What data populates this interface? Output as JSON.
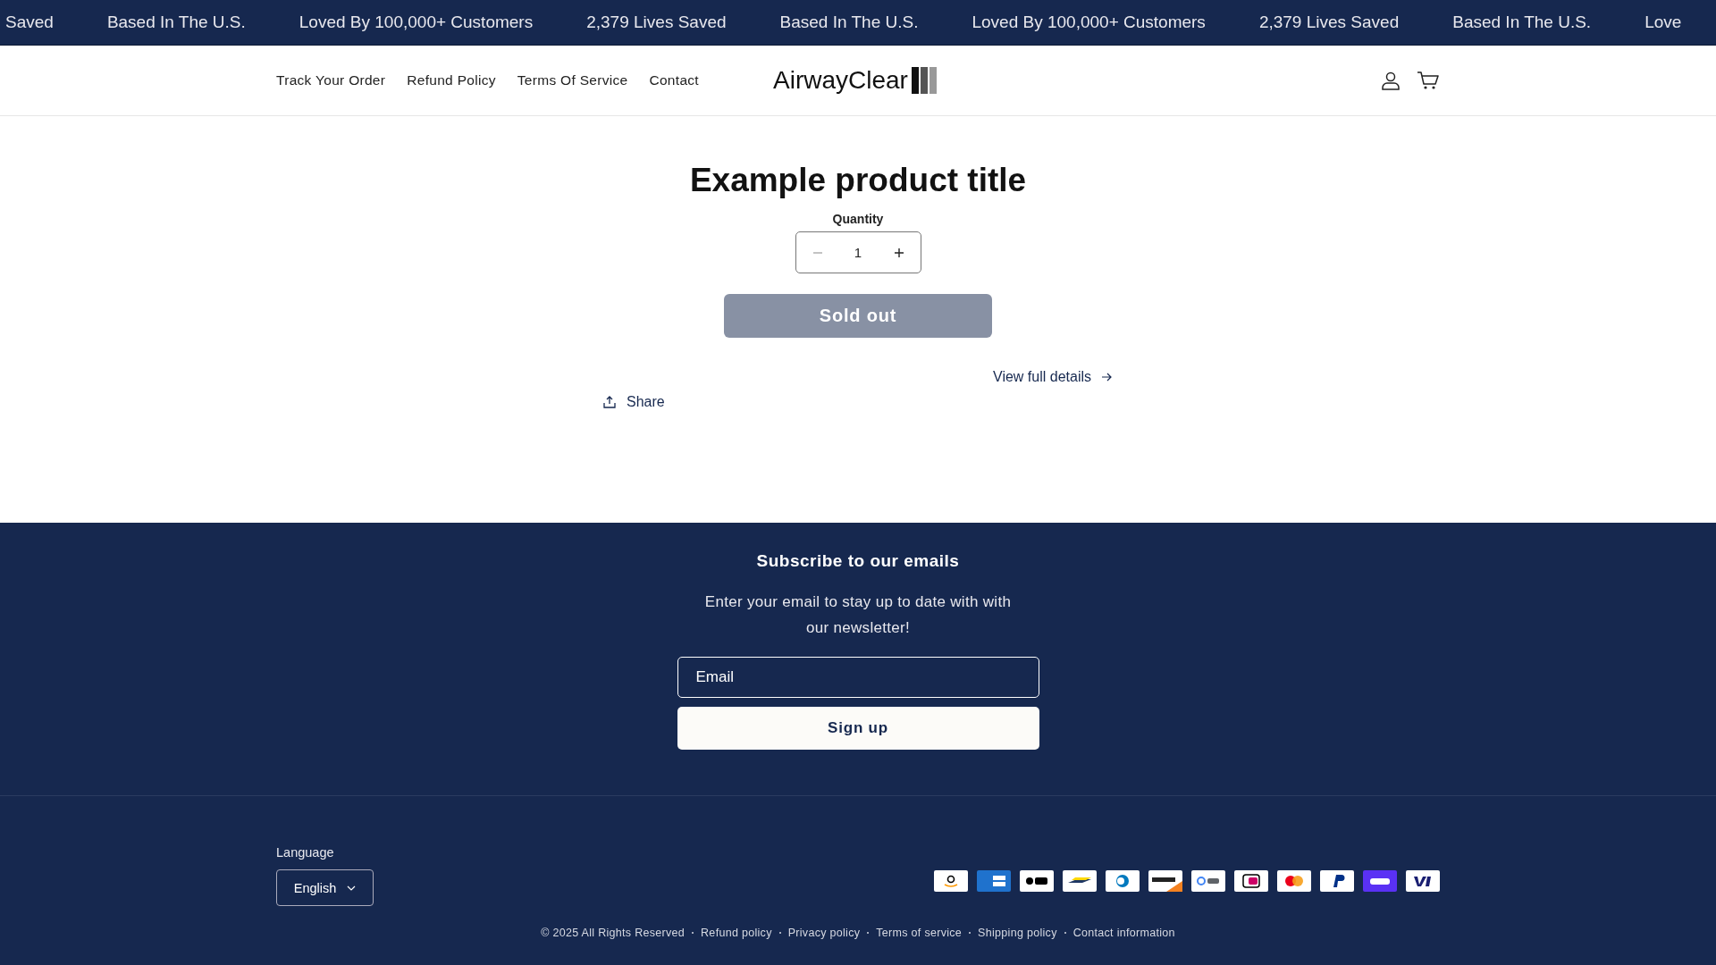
{
  "announcements": [
    "Saved",
    "Based In The U.S.",
    "Loved By 100,000+ Customers",
    "2,379 Lives Saved",
    "Based In The U.S.",
    "Loved By 100,000+ Customers",
    "2,379 Lives Saved",
    "Based In The U.S.",
    "Love"
  ],
  "nav": [
    "Track Your Order",
    "Refund Policy",
    "Terms Of Service",
    "Contact"
  ],
  "logo": "AirwayClear",
  "product": {
    "title": "Example product title",
    "quantity_label": "Quantity",
    "quantity": "1",
    "decrease_disabled": true,
    "buy_button": {
      "label": "Sold out",
      "disabled": true
    },
    "details_link": "View full details",
    "share": "Share"
  },
  "newsletter": {
    "heading": "Subscribe to our emails",
    "text": "Enter your email to stay up to date with with our newsletter!",
    "email_placeholder": "Email",
    "button": "Sign up"
  },
  "language": {
    "label": "Language",
    "value": "English"
  },
  "copyright": "© 2025 All Rights Reserved",
  "policies": [
    "Refund policy",
    "Privacy policy",
    "Terms of service",
    "Shipping policy",
    "Contact information"
  ]
}
